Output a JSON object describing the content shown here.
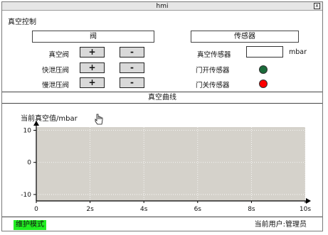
{
  "window": {
    "title": "hmi",
    "close_label": "x"
  },
  "vacuum_control": {
    "title": "真空控制",
    "valve_header": "阀",
    "sensor_header": "传感器",
    "valves": [
      {
        "label": "真空阀",
        "plus": "+",
        "minus": "-"
      },
      {
        "label": "快泄压阀",
        "plus": "+",
        "minus": "-"
      },
      {
        "label": "慢泄压阀",
        "plus": "+",
        "minus": "-"
      }
    ],
    "sensors": [
      {
        "label": "真空传感器",
        "value": "",
        "unit": "mbar"
      },
      {
        "label": "门开传感器",
        "status_color": "#1a6b3a"
      },
      {
        "label": "门关传感器",
        "status_color": "#ff0000"
      }
    ]
  },
  "curve_section": {
    "title": "真空曲线"
  },
  "chart_data": {
    "type": "line",
    "ylabel": "当前真空值/mbar",
    "xlabel": "",
    "x_ticks": [
      "0",
      "2s",
      "4s",
      "6s",
      "8s",
      "10s"
    ],
    "y_ticks": [
      "10",
      "0",
      "-10"
    ],
    "xlim": [
      0,
      10
    ],
    "ylim": [
      -12,
      11
    ],
    "grid": true,
    "plot_background": "#d5d2cb",
    "series": []
  },
  "status_bar": {
    "mode": "维护模式",
    "mode_color": "#22ee22",
    "user_label": "当前用户:管理员"
  }
}
